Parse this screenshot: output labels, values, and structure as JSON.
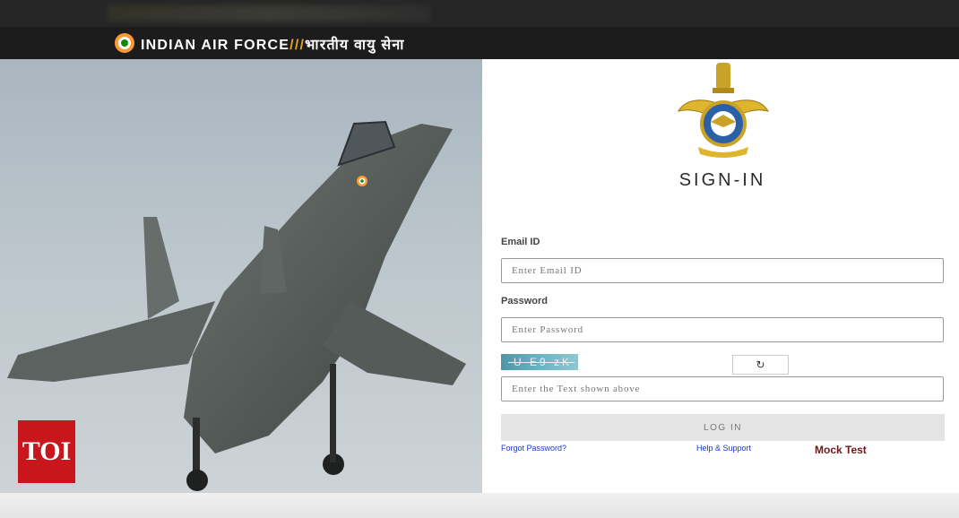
{
  "header": {
    "brand_en": "INDIAN AIR FORCE",
    "brand_sep": "///",
    "brand_hi": "भारतीय वायु सेना"
  },
  "icons": {
    "roundel": "iaf-roundel-icon",
    "emblem": "iaf-crest-emblem",
    "refresh": "refresh-icon"
  },
  "watermark": "TOI",
  "signin": {
    "title": "SIGN-IN",
    "email_label": "Email ID",
    "email_placeholder": "Enter Email ID",
    "email_value": "",
    "password_label": "Password",
    "password_placeholder": "Enter Password",
    "password_value": "",
    "captcha_text": "U E9  zK",
    "captcha_placeholder": "Enter the Text shown above",
    "captcha_value": "",
    "refresh_symbol": "↻",
    "login_label": "LOG IN",
    "forgot_label": "Forgot Password?",
    "help_label": "Help & Support",
    "mock_label": "Mock Test"
  },
  "colors": {
    "header_bg": "#1c1c1c",
    "saffron": "#ff9933",
    "green": "#138808",
    "link_blue": "#1a3bbf",
    "mock_maroon": "#6b1a1a",
    "toi_red": "#c9161c"
  }
}
